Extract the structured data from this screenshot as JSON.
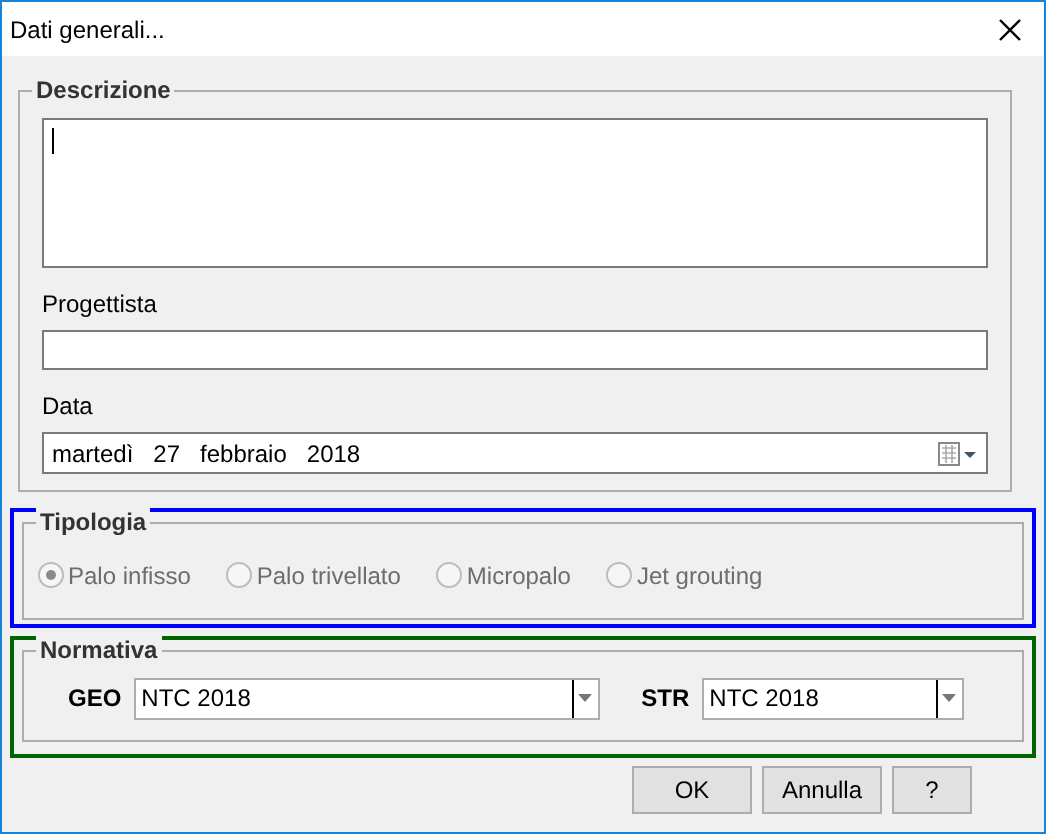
{
  "window": {
    "title": "Dati generali..."
  },
  "descrizione": {
    "legend": "Descrizione",
    "focused": true
  },
  "progettista": {
    "label": "Progettista"
  },
  "data": {
    "label": "Data",
    "value": "martedì   27   febbraio   2018"
  },
  "tipologia": {
    "legend": "Tipologia",
    "options": [
      {
        "label": "Palo infisso",
        "selected": true,
        "disabled": true
      },
      {
        "label": "Palo trivellato",
        "selected": false,
        "disabled": true
      },
      {
        "label": "Micropalo",
        "selected": false,
        "disabled": true
      },
      {
        "label": "Jet grouting",
        "selected": false,
        "disabled": true
      }
    ]
  },
  "normativa": {
    "legend": "Normativa",
    "fields": [
      {
        "label": "GEO",
        "value": "NTC 2018"
      },
      {
        "label": "STR",
        "value": "NTC 2018"
      }
    ]
  },
  "buttons": [
    "OK",
    "Annulla",
    "?"
  ]
}
